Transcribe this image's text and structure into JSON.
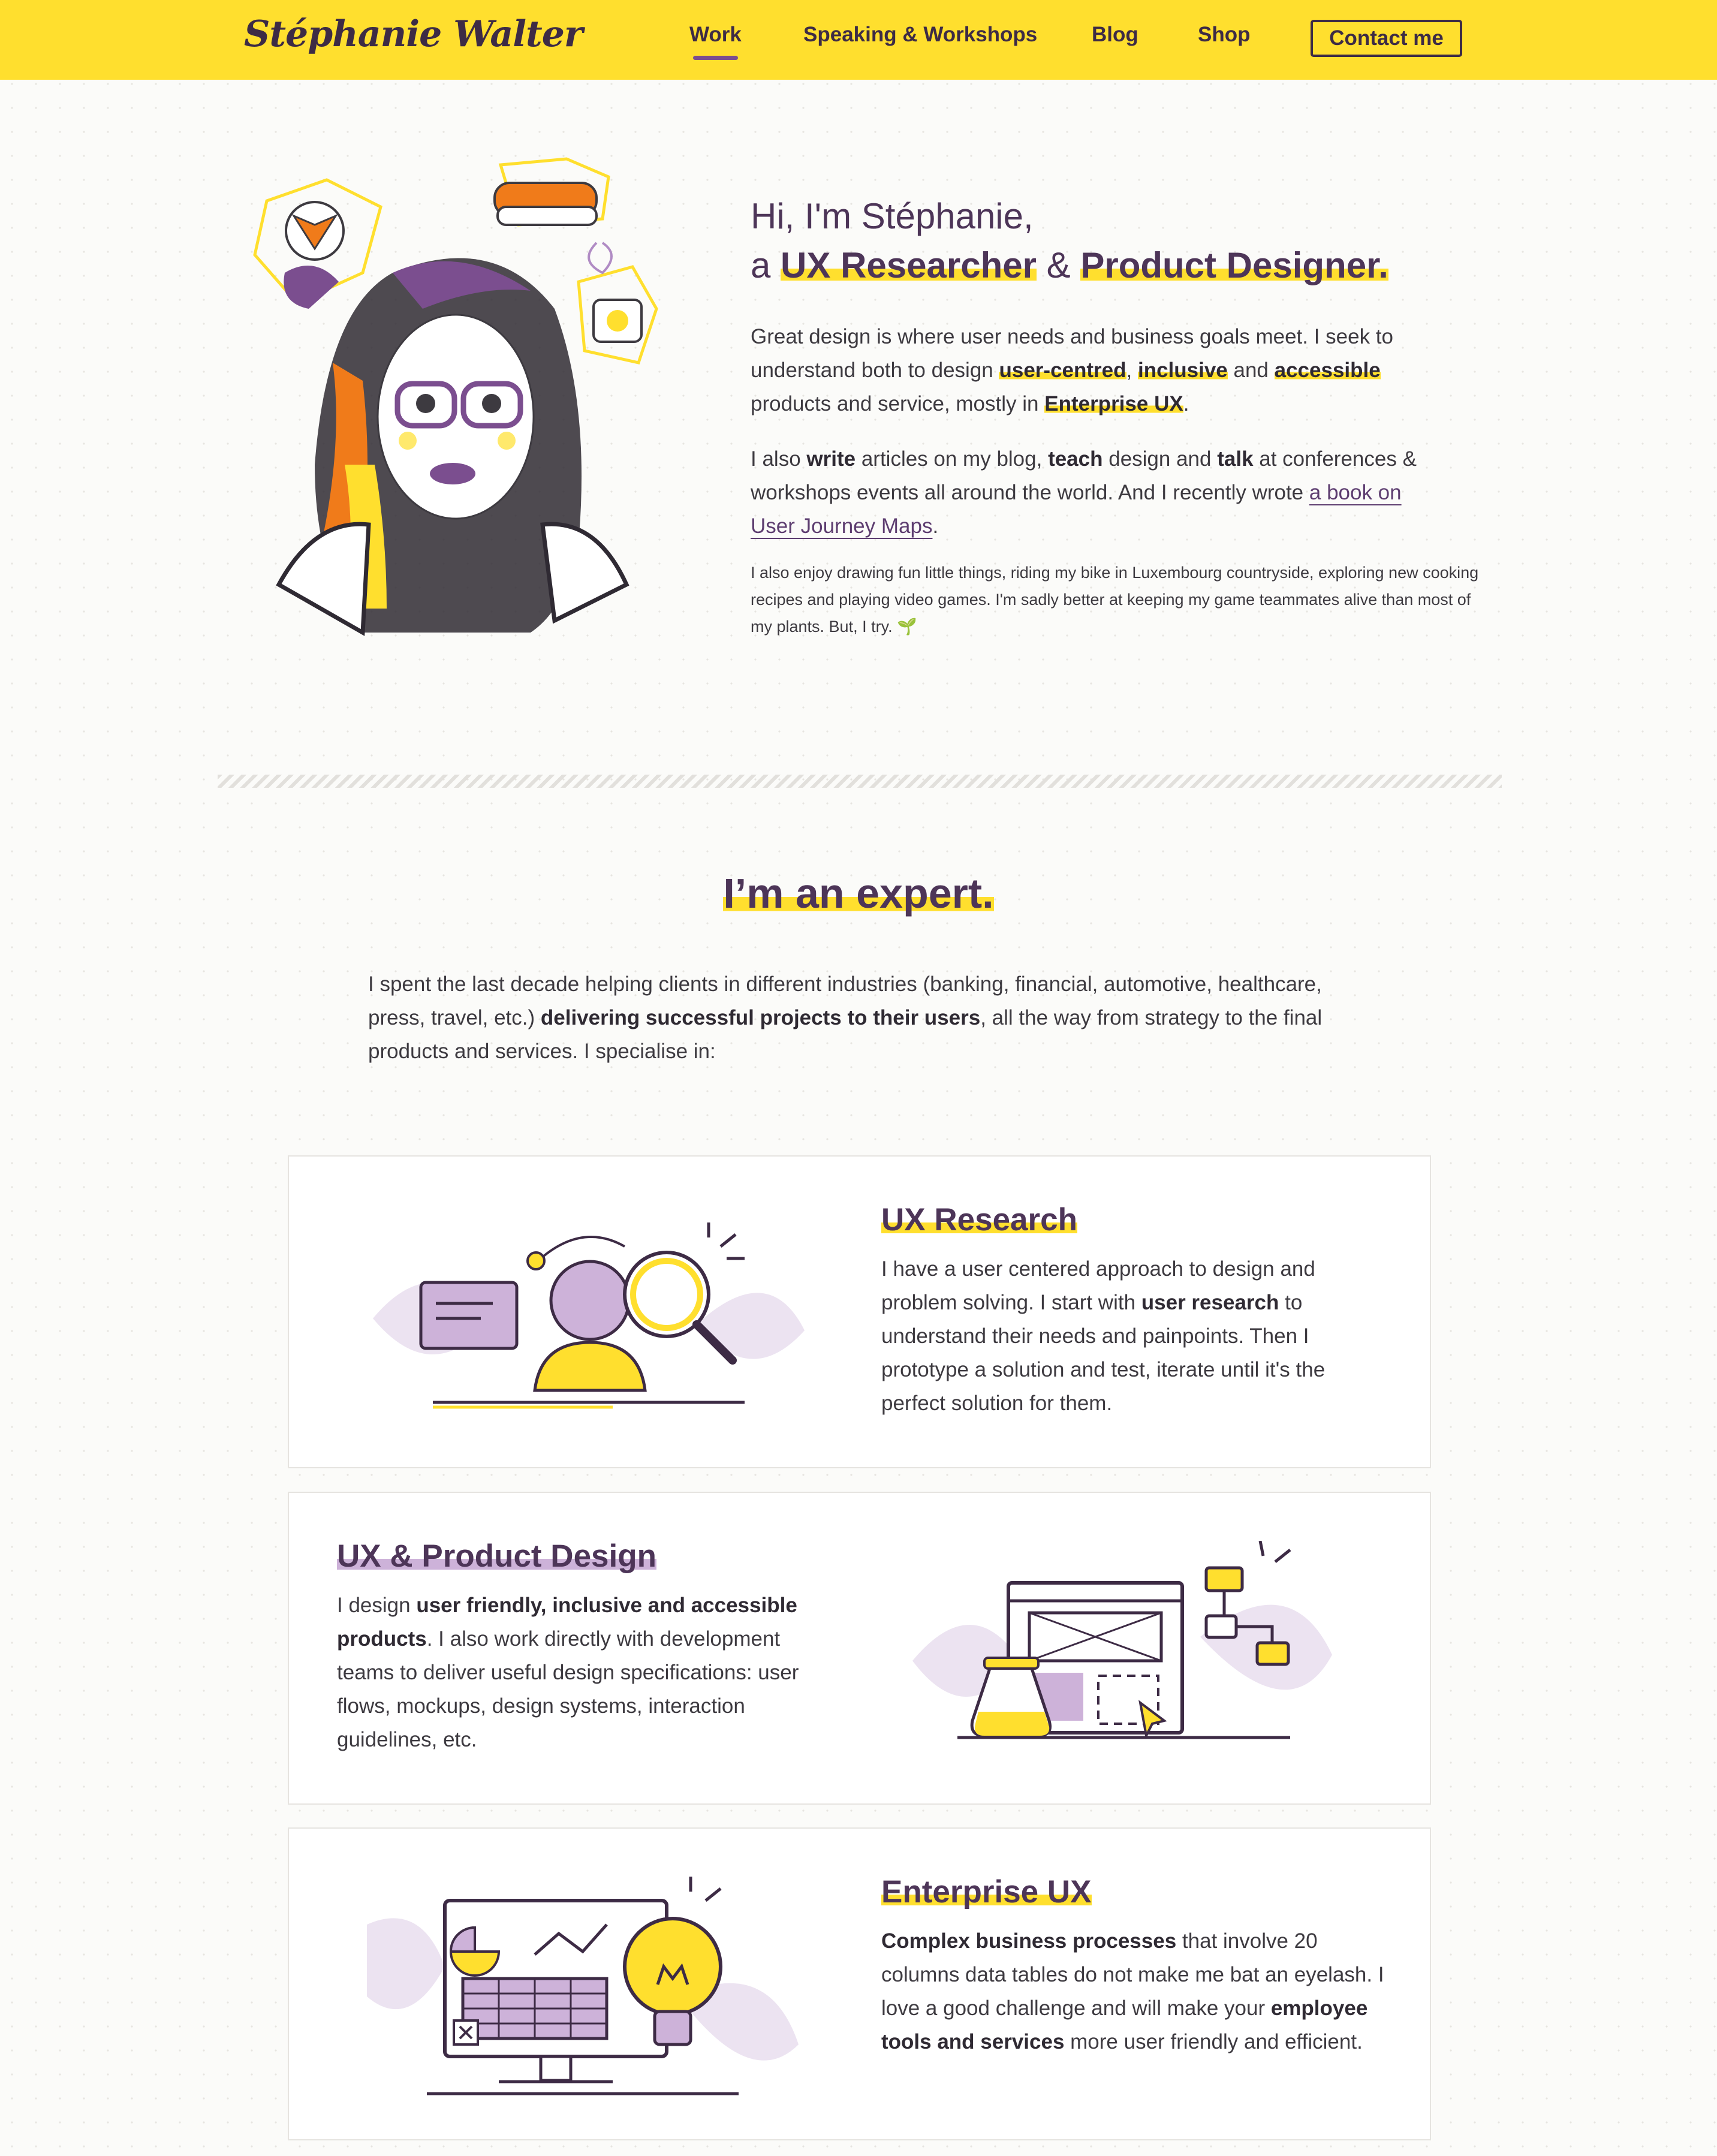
{
  "header": {
    "logo": "Stéphanie Walter",
    "nav": [
      {
        "label": "Work"
      },
      {
        "label": "Speaking & Workshops"
      },
      {
        "label": "Blog"
      },
      {
        "label": "Shop"
      }
    ],
    "contact": "Contact me"
  },
  "intro": {
    "line1": "Hi, I'm Stéphanie,",
    "line2_a": "a ",
    "role1": "UX Researcher",
    "amp": " & ",
    "role2": "Product Designer.",
    "p1": {
      "t1": "Great design is where user needs and business goals meet. I seek to understand both to design ",
      "k1": "user-centred",
      "t2": ", ",
      "k2": "inclusive",
      "t3": " and ",
      "k3": "accessible",
      "t4": " products and service, mostly in ",
      "k4": "Enterprise UX",
      "t5": "."
    },
    "p2": {
      "t1": "I also ",
      "k1": "write",
      "t2": " articles on my blog, ",
      "k2": "teach",
      "t3": " design and ",
      "k3": "talk",
      "t4": " at conferences & workshops events all around the world. And I recently wrote ",
      "link": "a book on User Journey Maps",
      "t5": "."
    },
    "p3": "I also enjoy drawing fun little things, riding my bike in Luxembourg countryside, exploring new cooking recipes and playing video games. I'm sadly better at keeping my game teammates alive than most of my plants. But, I try. 🌱"
  },
  "expert": {
    "title": "I’m an expert.",
    "p": {
      "t1": "I spent the last decade helping clients in different industries (banking, financial, automotive, healthcare, press, travel, etc.) ",
      "k1": "delivering successful projects to their users",
      "t2": ", all the way from strategy to the final products and services. I specialise in:"
    }
  },
  "cards": [
    {
      "title": "UX Research",
      "t1": "I have a user centered approach to design and problem solving. I start with ",
      "k1": "user research",
      "t2": " to understand their needs and painpoints. Then I prototype a solution and test, iterate until it's the perfect solution for them."
    },
    {
      "title": "UX & Product Design",
      "t1": "I design ",
      "k1": "user friendly, inclusive and accessible products",
      "t2": ". I also work directly with development teams to deliver useful design specifications: user flows, mockups, design systems, interaction guidelines, etc."
    },
    {
      "title": "Enterprise UX",
      "k1": "Complex business processes",
      "t1": " that involve 20 columns data tables do not make me bat an eyelash. I love a good challenge and will make your ",
      "k2": "employee tools and services",
      "t2": " more user friendly and efficient."
    }
  ],
  "colors": {
    "accent_yellow": "#ffdf2e",
    "accent_purple": "#7b4e8f",
    "text": "#3d3a40"
  },
  "icons": [
    "portrait-illustration",
    "research-illustration",
    "design-illustration",
    "enterprise-illustration"
  ]
}
